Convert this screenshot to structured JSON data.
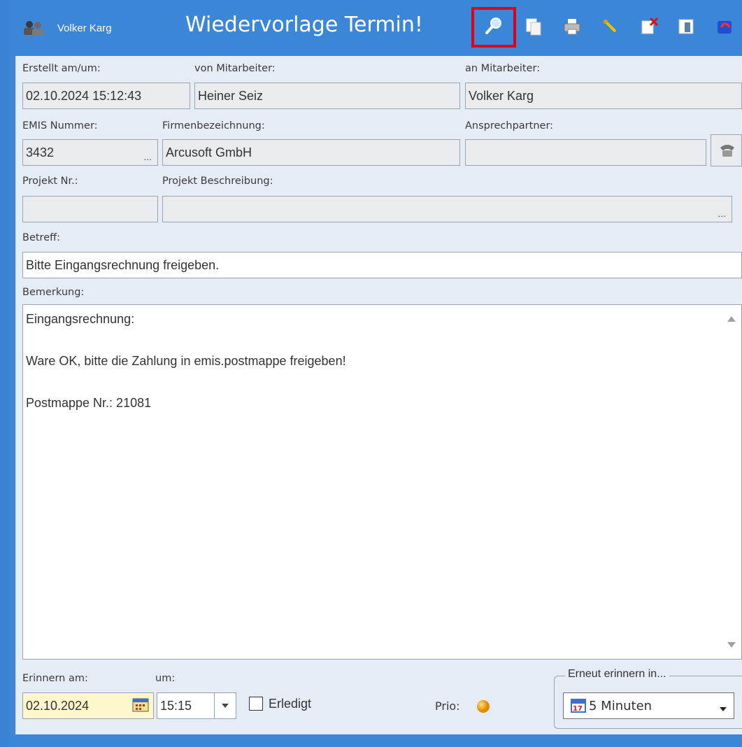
{
  "window": {
    "user_name": "Volker Karg",
    "title": "Wiedervorlage Termin!"
  },
  "toolbar": {
    "buttons": [
      {
        "icon": "search-icon",
        "selected": true
      },
      {
        "icon": "copy-icon",
        "selected": false
      },
      {
        "icon": "print-icon",
        "selected": false
      },
      {
        "icon": "pin-icon",
        "selected": false
      },
      {
        "icon": "delete-note-icon",
        "selected": false
      },
      {
        "icon": "book-icon",
        "selected": false
      },
      {
        "icon": "forward-icon",
        "selected": false
      }
    ]
  },
  "form": {
    "created_label": "Erstellt am/um:",
    "created_value": "02.10.2024 15:12:43",
    "from_label": "von Mitarbeiter:",
    "from_value": "Heiner Seiz",
    "to_label": "an Mitarbeiter:",
    "to_value": "Volker Karg",
    "emis_label": "EMIS Nummer:",
    "emis_value": "3432",
    "emis_dots": "...",
    "company_label": "Firmenbezeichnung:",
    "company_value": "Arcusoft GmbH",
    "contact_label": "Ansprechpartner:",
    "contact_value": "",
    "project_no_label": "Projekt Nr.:",
    "project_no_value": "",
    "project_desc_label": "Projekt Beschreibung:",
    "project_desc_value": "",
    "project_desc_dots": "...",
    "subject_label": "Betreff:",
    "subject_value": "Bitte Eingangsrechnung freigeben.",
    "remark_label": "Bemerkung:",
    "remark_lines": [
      "Eingangsrechnung:",
      "",
      "Ware OK, bitte die Zahlung in emis.postmappe freigeben!",
      "",
      "Postmappe Nr.: 21081"
    ],
    "remind_date_label": "Erinnern am:",
    "remind_date_value": "02.10.2024",
    "remind_time_label": "um:",
    "remind_time_value": "15:15",
    "done_label": "Erledigt",
    "done_checked": false,
    "prio_label": "Prio:",
    "prio_color": "#f5a300",
    "again_label": "Erneut erinnern in...",
    "again_value": "5 Minuten"
  },
  "colors": {
    "titlebar": "#3c86d8",
    "highlight": "#e0001a",
    "panel": "#e6ecf5"
  }
}
